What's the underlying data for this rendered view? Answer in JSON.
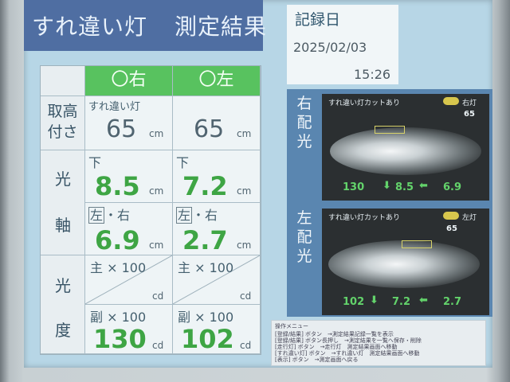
{
  "app": {
    "title": "すれ違い灯",
    "subtitle": "測定結果"
  },
  "date": {
    "label": "記録日",
    "date": "2025/02/03",
    "time": "15:26"
  },
  "table": {
    "columns": [
      "〇右",
      "〇左"
    ],
    "row_labels": {
      "height": "取高付さ",
      "axis": "光\n軸",
      "intensity": "光\n度"
    },
    "height": {
      "note": "すれ違い灯",
      "right": "65",
      "left": "65",
      "unit": "cm"
    },
    "axis_vertical": {
      "direction": "下",
      "right": "8.5",
      "left": "7.2",
      "unit": "cm"
    },
    "axis_horizontal": {
      "left_label": "左",
      "sep": "・",
      "right_label": "右",
      "right": "6.9",
      "left": "2.7",
      "unit": "cm"
    },
    "intensity_main": {
      "label": "主 × 100",
      "unit": "cd"
    },
    "intensity_sub": {
      "label": "副 × 100",
      "right": "130",
      "left": "102",
      "unit": "cd"
    }
  },
  "distribution": {
    "right_label": "右\n配\n光",
    "left_label": "左\n配\n光",
    "right_panel": {
      "caption": "すれ違い灯カットあり",
      "tag": "右灯",
      "value_top": "65",
      "bottom_values": [
        "130",
        "8.5",
        "6.9"
      ]
    },
    "left_panel": {
      "caption": "すれ違い灯カットあり",
      "tag": "左灯",
      "value_top": "65",
      "bottom_values": [
        "102",
        "7.2",
        "2.7"
      ]
    }
  },
  "menu": {
    "title": "操作メニュー",
    "lines": [
      "[登録/結果] ボタン　→測定結果記録一覧を表示",
      "[登録/結果] ボタン長押し　→測定結果を一覧へ保存・削除",
      "[走行灯] ボタン　→走行灯　測定結果画面へ移動",
      "[すれ違い灯] ボタン　→すれ違い灯　測定結果画面へ移動",
      "[表示] ボタン　→測定画面へ戻る"
    ]
  },
  "colors": {
    "header_green": "#58c25f",
    "value_green": "#3ea544",
    "title_blue": "#4f6ea2"
  }
}
